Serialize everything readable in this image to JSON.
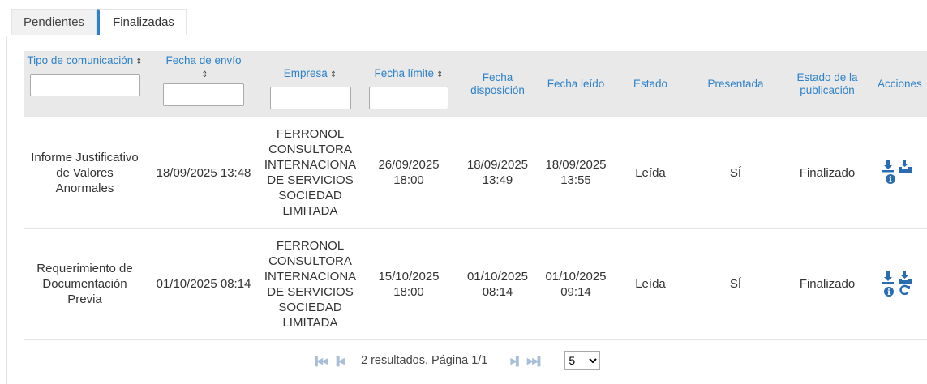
{
  "tabs": [
    {
      "label": "Pendientes"
    },
    {
      "label": "Finalizadas"
    }
  ],
  "columns": {
    "tipo": "Tipo de comunicación",
    "fecha_envio": "Fecha de envío",
    "empresa": "Empresa",
    "fecha_limite": "Fecha límite",
    "fecha_disposicion": "Fecha disposición",
    "fecha_leido": "Fecha leído",
    "estado": "Estado",
    "presentada": "Presentada",
    "estado_publicacion": "Estado de la publicación",
    "acciones": "Acciones"
  },
  "sort_icon": "⇕",
  "rows": [
    {
      "tipo": "Informe Justificativo de Valores Anormales",
      "fecha_envio": "18/09/2025 13:48",
      "empresa": "FERRONOL CONSULTORA INTERNACIONA DE SERVICIOS SOCIEDAD LIMITADA",
      "fecha_limite": "26/09/2025 18:00",
      "fecha_disposicion": "18/09/2025 13:49",
      "fecha_leido": "18/09/2025 13:55",
      "estado": "Leída",
      "presentada": "SÍ",
      "estado_publicacion": "Finalizado",
      "actions": [
        "download-info-icon",
        "inbox-icon"
      ]
    },
    {
      "tipo": "Requerimiento de Documentación Previa",
      "fecha_envio": "01/10/2025 08:14",
      "empresa": "FERRONOL CONSULTORA INTERNACIONA DE SERVICIOS SOCIEDAD LIMITADA",
      "fecha_limite": "15/10/2025 18:00",
      "fecha_disposicion": "01/10/2025 08:14",
      "fecha_leido": "01/10/2025 09:14",
      "estado": "Leída",
      "presentada": "SÍ",
      "estado_publicacion": "Finalizado",
      "actions": [
        "download-info-icon",
        "inbox-refresh-icon"
      ]
    }
  ],
  "pagination": {
    "summary": "2 resultados, Página 1/1",
    "page_size": "5",
    "page_size_options": [
      "5"
    ]
  },
  "colors": {
    "accent": "#2e82c9",
    "icon": "#2a6cb0",
    "header_bg": "#e9e9e9"
  }
}
